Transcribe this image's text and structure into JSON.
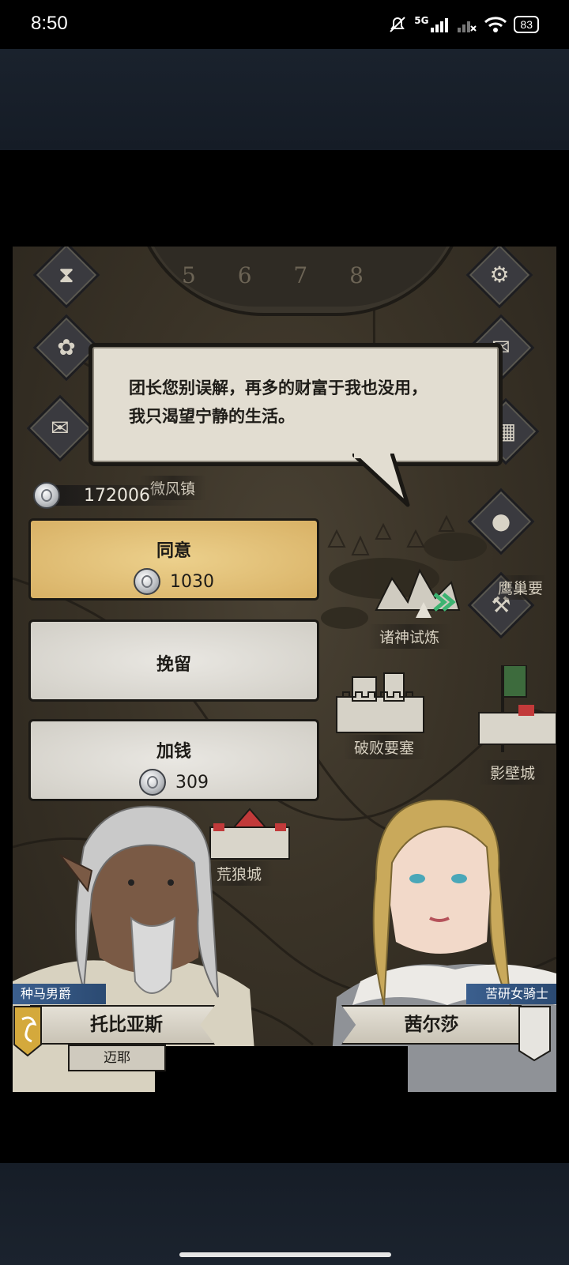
{
  "status_bar": {
    "time": "8:50",
    "network": "5G",
    "battery": "83"
  },
  "game": {
    "wheel_numbers": "5 6 7 8",
    "currency": {
      "icon": "silver-coin-icon",
      "amount": "172006"
    },
    "dialog": {
      "line1": "团长您别误解，再多的财富于我也没用，",
      "line2": "我只渴望宁静的生活。"
    },
    "options": [
      {
        "label": "同意",
        "cost": "1030"
      },
      {
        "label": "挽留"
      },
      {
        "label": "加钱",
        "cost": "309"
      }
    ],
    "places": {
      "weifeng": "微风镇",
      "zhushen": "诸神试炼",
      "pobai": "破败要塞",
      "huanglang": "荒狼城",
      "yingbi": "影壁城",
      "right_edge": "鹰巢要"
    },
    "left_character": {
      "title": "种马男爵",
      "name": "托比亚斯",
      "subname": "迈耶"
    },
    "right_character": {
      "title": "苦研女骑士",
      "name": "茜尔莎"
    },
    "side_icons": [
      "hourglass-icon",
      "money-bag-icon",
      "scroll-icon",
      "gear-icon",
      "mail-icon",
      "building-icon",
      "coin-icon",
      "hammer-icon"
    ]
  }
}
